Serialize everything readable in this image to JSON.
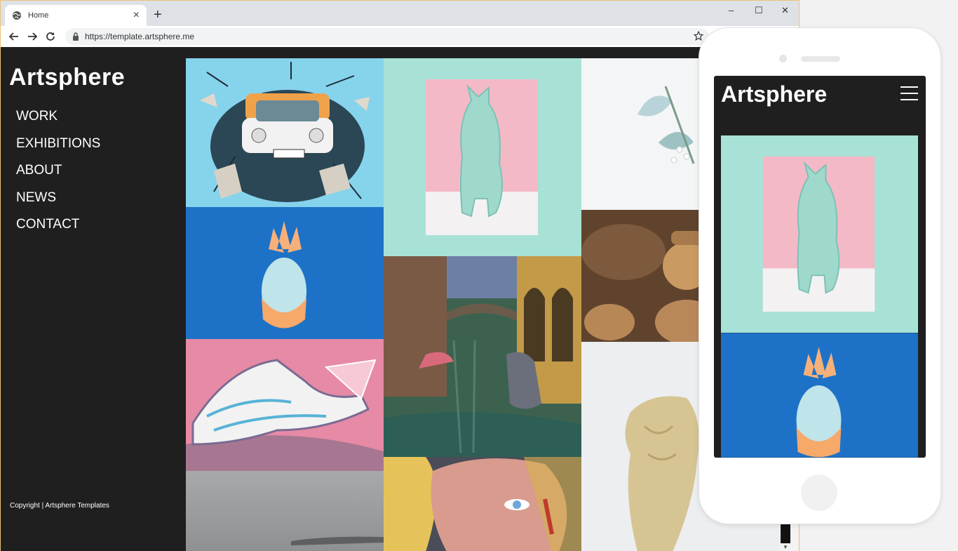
{
  "browser": {
    "tab_title": "Home",
    "url": "https://template.artsphere.me",
    "new_tab_symbol": "+",
    "tab_close_symbol": "×",
    "window_controls": {
      "minimize": "–",
      "maximize": "☐",
      "close": "✕"
    }
  },
  "site": {
    "brand": "Artsphere",
    "nav": [
      "WORK",
      "EXHIBITIONS",
      "ABOUT",
      "NEWS",
      "CONTACT"
    ],
    "copyright": "Copyright | Artsphere Templates"
  },
  "gallery": {
    "items": [
      {
        "name": "trabant-car-mural",
        "colors": [
          "#8fd7ee",
          "#5ec3e6"
        ]
      },
      {
        "name": "pastel-pineapple",
        "colors": [
          "#1d74c8",
          "#2a8ee0"
        ]
      },
      {
        "name": "painted-hand-mural",
        "colors": [
          "#e88aa6",
          "#d56f91"
        ]
      },
      {
        "name": "foggy-lake",
        "colors": [
          "#a8aaab",
          "#8b8d8e"
        ]
      },
      {
        "name": "cat-figurine",
        "colors": [
          "#a9e3d8",
          "#b8ebe0"
        ]
      },
      {
        "name": "venice-canal",
        "colors": [
          "#3f6a57",
          "#8a6a3a"
        ]
      },
      {
        "name": "pop-art-woman",
        "colors": [
          "#c98f86",
          "#e5c35a"
        ]
      },
      {
        "name": "white-flowers",
        "colors": [
          "#f3f5f6",
          "#cfe0e2"
        ]
      },
      {
        "name": "wooden-figurines",
        "colors": [
          "#6b4a32",
          "#b78754"
        ]
      },
      {
        "name": "classical-torso",
        "colors": [
          "#eef0f2",
          "#d8c79a"
        ]
      }
    ]
  },
  "phone": {
    "brand": "Artsphere"
  },
  "colors": {
    "dark_bg": "#1f1f1f",
    "text": "#ffffff",
    "chrome": "#dee1e6"
  }
}
